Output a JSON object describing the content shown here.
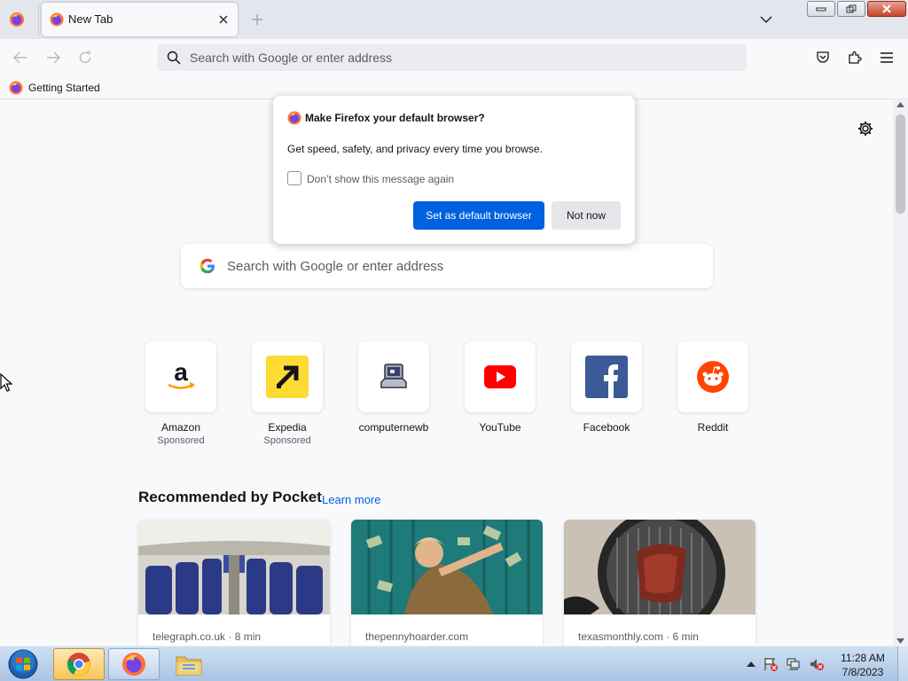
{
  "browser": {
    "tab": {
      "title": "New Tab"
    },
    "urlbar": {
      "placeholder": "Search with Google or enter address"
    },
    "bookmarks": [
      {
        "label": "Getting Started"
      }
    ],
    "window_controls": [
      "minimize",
      "restore",
      "close"
    ]
  },
  "newtab": {
    "search": {
      "placeholder": "Search with Google or enter address"
    },
    "top_sites": [
      {
        "name": "Amazon",
        "sponsor": "Sponsored",
        "icon": "amazon-icon"
      },
      {
        "name": "Expedia",
        "sponsor": "Sponsored",
        "icon": "expedia-icon"
      },
      {
        "name": "computernewb",
        "sponsor": "",
        "icon": "computernewb-icon"
      },
      {
        "name": "YouTube",
        "sponsor": "",
        "icon": "youtube-icon"
      },
      {
        "name": "Facebook",
        "sponsor": "",
        "icon": "facebook-icon"
      },
      {
        "name": "Reddit",
        "sponsor": "",
        "icon": "reddit-icon"
      }
    ],
    "pocket": {
      "title": "Recommended by Pocket",
      "learn_more": "Learn more",
      "cards": [
        {
          "source": "telegraph.co.uk · 8 min"
        },
        {
          "source": "thepennyhoarder.com"
        },
        {
          "source": "texasmonthly.com · 6 min"
        }
      ]
    }
  },
  "dialog": {
    "title": "Make Firefox your default browser?",
    "body": "Get speed, safety, and privacy every time you browse.",
    "checkbox_label": "Don’t show this message again",
    "checkbox_checked": false,
    "primary_button": "Set as default browser",
    "secondary_button": "Not now"
  },
  "taskbar": {
    "apps": [
      "chrome",
      "firefox",
      "file-explorer"
    ],
    "clock": {
      "time": "11:28 AM",
      "date": "7/8/2023"
    }
  },
  "colors": {
    "accent": "#0061e0",
    "taskbar": "#a9c4e4"
  }
}
